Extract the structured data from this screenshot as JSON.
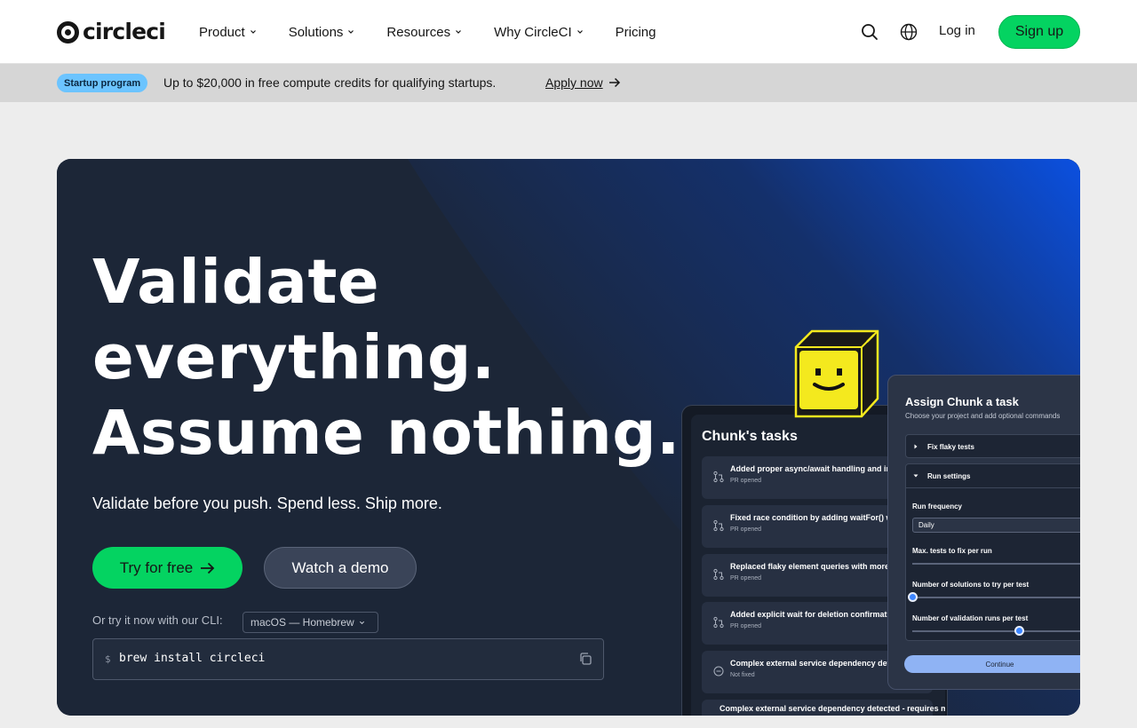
{
  "nav": {
    "logo_text": "circleci",
    "menu": [
      {
        "label": "Product",
        "has_dropdown": true
      },
      {
        "label": "Solutions",
        "has_dropdown": true
      },
      {
        "label": "Resources",
        "has_dropdown": true
      },
      {
        "label": "Why CircleCI",
        "has_dropdown": true
      },
      {
        "label": "Pricing",
        "has_dropdown": false
      }
    ],
    "login_label": "Log in",
    "signup_label": "Sign up"
  },
  "banner": {
    "badge": "Startup program",
    "text": "Up to $20,000 in free compute credits for qualifying startups.",
    "link": "Apply now"
  },
  "hero": {
    "headline_lines": [
      "Validate",
      "everything.",
      "Assume nothing."
    ],
    "subheadline": "Validate before you push. Spend less. Ship more.",
    "try_label": "Try for free",
    "demo_label": "Watch a demo",
    "cli_label": "Or try it now with our CLI:",
    "cli_select": "macOS — Homebrew",
    "cli_prompt": "$",
    "cli_command": "brew install circleci"
  },
  "tasks": {
    "title": "Chunk's tasks",
    "items": [
      {
        "title": "Added proper async/await handling and inc",
        "status": "PR opened"
      },
      {
        "title": "Fixed race condition by adding waitFor() wr",
        "status": "PR opened"
      },
      {
        "title": "Replaced flaky element queries with more r",
        "status": "PR opened"
      },
      {
        "title": "Added explicit wait for deletion confirmatio",
        "status": "PR opened"
      },
      {
        "title": "Complex external service dependency dete",
        "status": "Not fixed"
      },
      {
        "title": "Complex external service dependency detected - requires manual review",
        "status": ""
      }
    ]
  },
  "assign": {
    "title": "Assign Chunk a task",
    "subtitle": "Choose your project and add optional commands",
    "section_fix": "Fix flaky tests",
    "section_run": "Run settings",
    "run_frequency_label": "Run frequency",
    "run_frequency_value": "Daily",
    "max_tests_label": "Max. tests to fix per run",
    "solutions_label": "Number of solutions to try per test",
    "solutions_level": 0.0,
    "validation_label": "Number of validation runs per test",
    "validation_level": 0.6,
    "continue_label": "Continue"
  },
  "colors": {
    "accent_green": "#04d361",
    "hero_dark": "#1c2637",
    "hero_blue": "#0b4fd6",
    "badge_blue": "#6cc4ff",
    "chunk_yellow": "#f4e91e"
  },
  "icons": {
    "search": "search-icon",
    "globe": "globe-icon",
    "copy": "copy-icon",
    "arrow": "arrow-right-icon"
  }
}
